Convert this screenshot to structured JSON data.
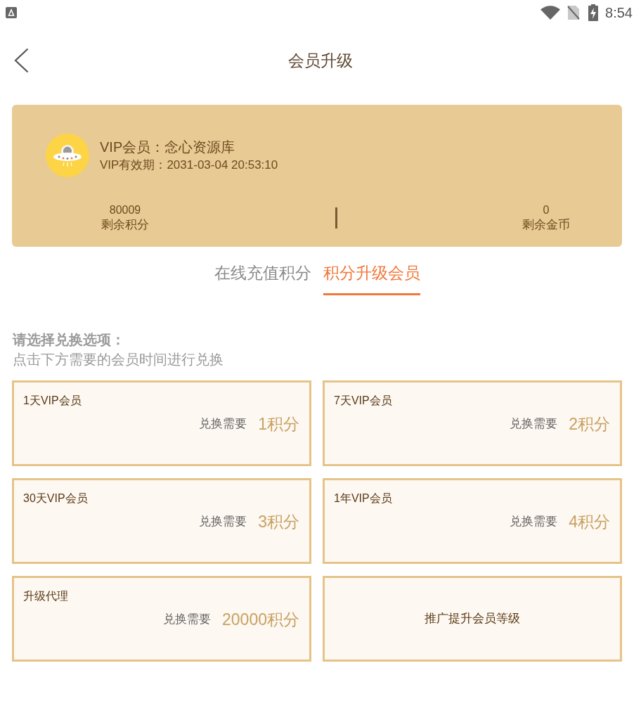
{
  "status_bar": {
    "time": "8:54"
  },
  "header": {
    "title": "会员升级"
  },
  "vip_card": {
    "member": "VIP会员：念心资源库",
    "expiry": "VIP有效期：2031-03-04 20:53:10",
    "stats": [
      {
        "value": "80009",
        "label": "剩余积分"
      },
      {
        "value": "0",
        "label": "剩余金币"
      }
    ]
  },
  "tabs": [
    {
      "label": "在线充值积分",
      "selected": false
    },
    {
      "label": "积分升级会员",
      "selected": true
    }
  ],
  "section": {
    "title": "请选择兑换选项：",
    "subtitle": "点击下方需要的会员时间进行兑换"
  },
  "options": [
    {
      "kind": "exchange",
      "title": "1天VIP会员",
      "cost_label": "兑换需要",
      "cost": "1积分"
    },
    {
      "kind": "exchange",
      "title": "7天VIP会员",
      "cost_label": "兑换需要",
      "cost": "2积分"
    },
    {
      "kind": "exchange",
      "title": "30天VIP会员",
      "cost_label": "兑换需要",
      "cost": "3积分"
    },
    {
      "kind": "exchange",
      "title": "1年VIP会员",
      "cost_label": "兑换需要",
      "cost": "4积分"
    },
    {
      "kind": "exchange",
      "title": "升级代理",
      "cost_label": "兑换需要",
      "cost": "20000积分"
    },
    {
      "kind": "link",
      "label": "推广提升会员等级"
    }
  ]
}
